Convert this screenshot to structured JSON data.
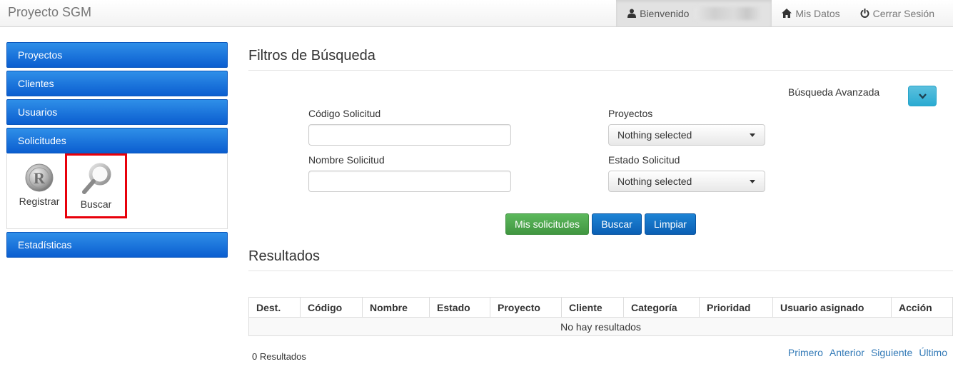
{
  "navbar": {
    "brand": "Proyecto SGM",
    "welcome": "Bienvenido",
    "my_data": "Mis Datos",
    "logout": "Cerrar Sesión"
  },
  "sidebar": {
    "items": [
      {
        "label": "Proyectos"
      },
      {
        "label": "Clientes"
      },
      {
        "label": "Usuarios"
      },
      {
        "label": "Solicitudes"
      },
      {
        "label": "Estadísticas"
      }
    ],
    "submenu": {
      "register_label": "Registrar",
      "search_label": "Buscar"
    }
  },
  "filters": {
    "title": "Filtros de Búsqueda",
    "advanced_label": "Búsqueda Avanzada",
    "code_label": "Código Solicitud",
    "code_value": "",
    "name_label": "Nombre Solicitud",
    "name_value": "",
    "projects_label": "Proyectos",
    "projects_value": "Nothing selected",
    "status_label": "Estado Solicitud",
    "status_value": "Nothing selected",
    "btn_my_requests": "Mis solicitudes",
    "btn_search": "Buscar",
    "btn_clear": "Limpiar"
  },
  "results": {
    "title": "Resultados",
    "columns": [
      "Dest.",
      "Código",
      "Nombre",
      "Estado",
      "Proyecto",
      "Cliente",
      "Categoría",
      "Prioridad",
      "Usuario asignado",
      "Acción"
    ],
    "empty_message": "No hay resultados",
    "count_text": "0 Resultados",
    "pager": {
      "first": "Primero",
      "prev": "Anterior",
      "next": "Siguiente",
      "last": "Último"
    }
  },
  "colors": {
    "menu_blue": "#0b5ed0",
    "success": "#5cb85c",
    "primary": "#0b5fb4",
    "info": "#5bc0de",
    "highlight": "#e8000b",
    "link": "#337ab7"
  }
}
